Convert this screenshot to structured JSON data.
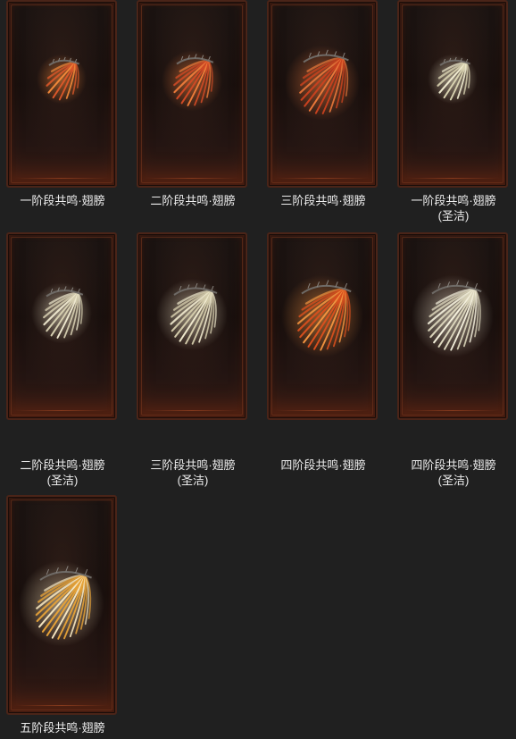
{
  "items": [
    {
      "line1": "一阶段共鸣·翅膀",
      "line2": "",
      "icon": "wing-stage1-icon",
      "color": "#d9572a",
      "glow": "#f2893a",
      "size": 0.7,
      "rays": 9
    },
    {
      "line1": "二阶段共鸣·翅膀",
      "line2": "",
      "icon": "wing-stage2-icon",
      "color": "#cf4a25",
      "glow": "#ef7c3a",
      "size": 0.85,
      "rays": 11
    },
    {
      "line1": "三阶段共鸣·翅膀",
      "line2": "",
      "icon": "wing-stage3-icon",
      "color": "#c8421f",
      "glow": "#e9773a",
      "size": 1.05,
      "rays": 13
    },
    {
      "line1": "一阶段共鸣·翅膀",
      "line2": "(圣洁)",
      "icon": "wing-stage1-holy-icon",
      "color": "#d8d2b0",
      "glow": "#f1ecd0",
      "size": 0.7,
      "rays": 9
    },
    {
      "line1": "二阶段共鸣·翅膀",
      "line2": "(圣洁)",
      "icon": "wing-stage2-holy-icon",
      "color": "#d6ceb0",
      "glow": "#efe9cf",
      "size": 0.85,
      "rays": 11
    },
    {
      "line1": "三阶段共鸣·翅膀",
      "line2": "(圣洁)",
      "icon": "wing-stage3-holy-icon",
      "color": "#d3cbab",
      "glow": "#eee8cc",
      "size": 1.0,
      "rays": 13
    },
    {
      "line1": "四阶段共鸣·翅膀",
      "line2": "",
      "icon": "wing-stage4-icon",
      "color": "#d9501e",
      "glow": "#f39440",
      "size": 1.15,
      "rays": 15
    },
    {
      "line1": "四阶段共鸣·翅膀",
      "line2": "(圣洁)",
      "icon": "wing-stage4-holy-icon",
      "color": "#dcd6bc",
      "glow": "#f5f1dd",
      "size": 1.15,
      "rays": 15
    },
    {
      "line1": "五阶段共鸣·翅膀",
      "line2": "",
      "icon": "wing-stage5-icon",
      "color": "#e6a238",
      "glow": "#f7e7c0",
      "size": 1.2,
      "rays": 17
    }
  ]
}
